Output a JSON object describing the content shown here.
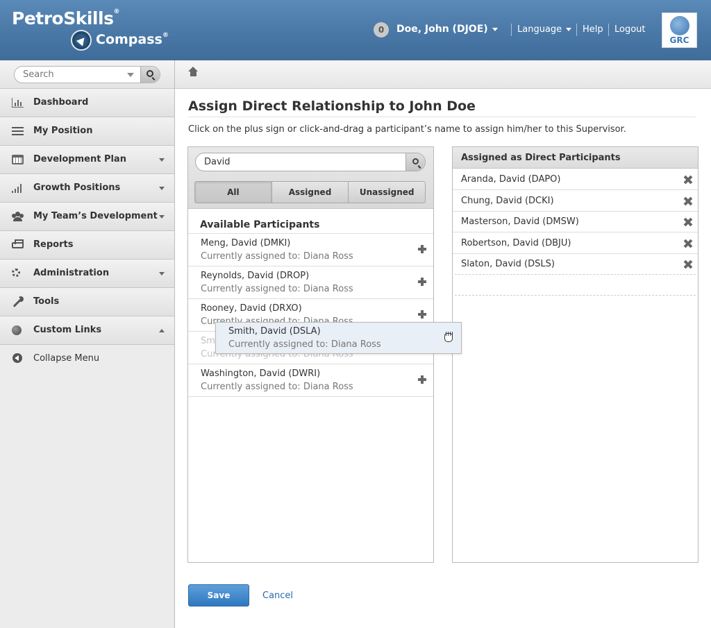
{
  "header": {
    "logo_line1": "PetroSkills",
    "logo_line2": "Compass",
    "reg_mark": "®",
    "notification_count": "0",
    "user_name": "Doe, John (DJOE)",
    "language_label": "Language",
    "help_label": "Help",
    "logout_label": "Logout",
    "grc_label": "GRC"
  },
  "sidebar": {
    "search_placeholder": "Search",
    "items": [
      {
        "label": "Dashboard",
        "icon": "chart-icon"
      },
      {
        "label": "My Position",
        "icon": "list-icon"
      },
      {
        "label": "Development Plan",
        "icon": "calendar-icon",
        "caret": "down"
      },
      {
        "label": "Growth Positions",
        "icon": "signal-icon",
        "caret": "down"
      },
      {
        "label": "My Team’s Development",
        "icon": "team-icon",
        "caret": "down"
      },
      {
        "label": "Reports",
        "icon": "printer-icon"
      },
      {
        "label": "Administration",
        "icon": "gear-icon",
        "caret": "down"
      },
      {
        "label": "Tools",
        "icon": "wrench-icon"
      },
      {
        "label": "Custom Links",
        "icon": "globe-icon",
        "caret": "up"
      }
    ],
    "collapse_label": "Collapse Menu"
  },
  "main": {
    "title": "Assign Direct Relationship to John Doe",
    "instructions": "Click on the plus sign or click-and-drag a participant’s name to assign him/her to this Supervisor.",
    "filter_value": "David",
    "segments": [
      "All",
      "Assigned",
      "Unassigned"
    ],
    "active_segment": "All",
    "available_heading": "Available Participants",
    "available": [
      {
        "name": "Meng, David (DMKI)",
        "sub": "Currently assigned to: Diana Ross"
      },
      {
        "name": "Reynolds, David (DROP)",
        "sub": "Currently assigned to: Diana Ross"
      },
      {
        "name": "Rooney, David (DRXO)",
        "sub": "Currently assigned to: Diana Ross"
      },
      {
        "name": "Smith, David (DSLA)",
        "sub": "Currently assigned to: Diana Ross"
      },
      {
        "name": "Washington, David (DWRI)",
        "sub": "Currently assigned to: Diana Ross"
      }
    ],
    "dragging": {
      "name": "Smith, David (DSLA)",
      "sub": "Currently assigned to: Diana Ross"
    },
    "assigned_heading": "Assigned as Direct Participants",
    "assigned": [
      "Aranda, David (DAPO)",
      "Chung, David (DCKI)",
      "Masterson, David (DMSW)",
      "Robertson, David (DBJU)",
      "Slaton, David (DSLS)"
    ],
    "save_label": "Save",
    "cancel_label": "Cancel"
  },
  "colors": {
    "header_blue": "#4a78a6",
    "primary_button": "#2f78be",
    "link": "#2a6aa8"
  }
}
